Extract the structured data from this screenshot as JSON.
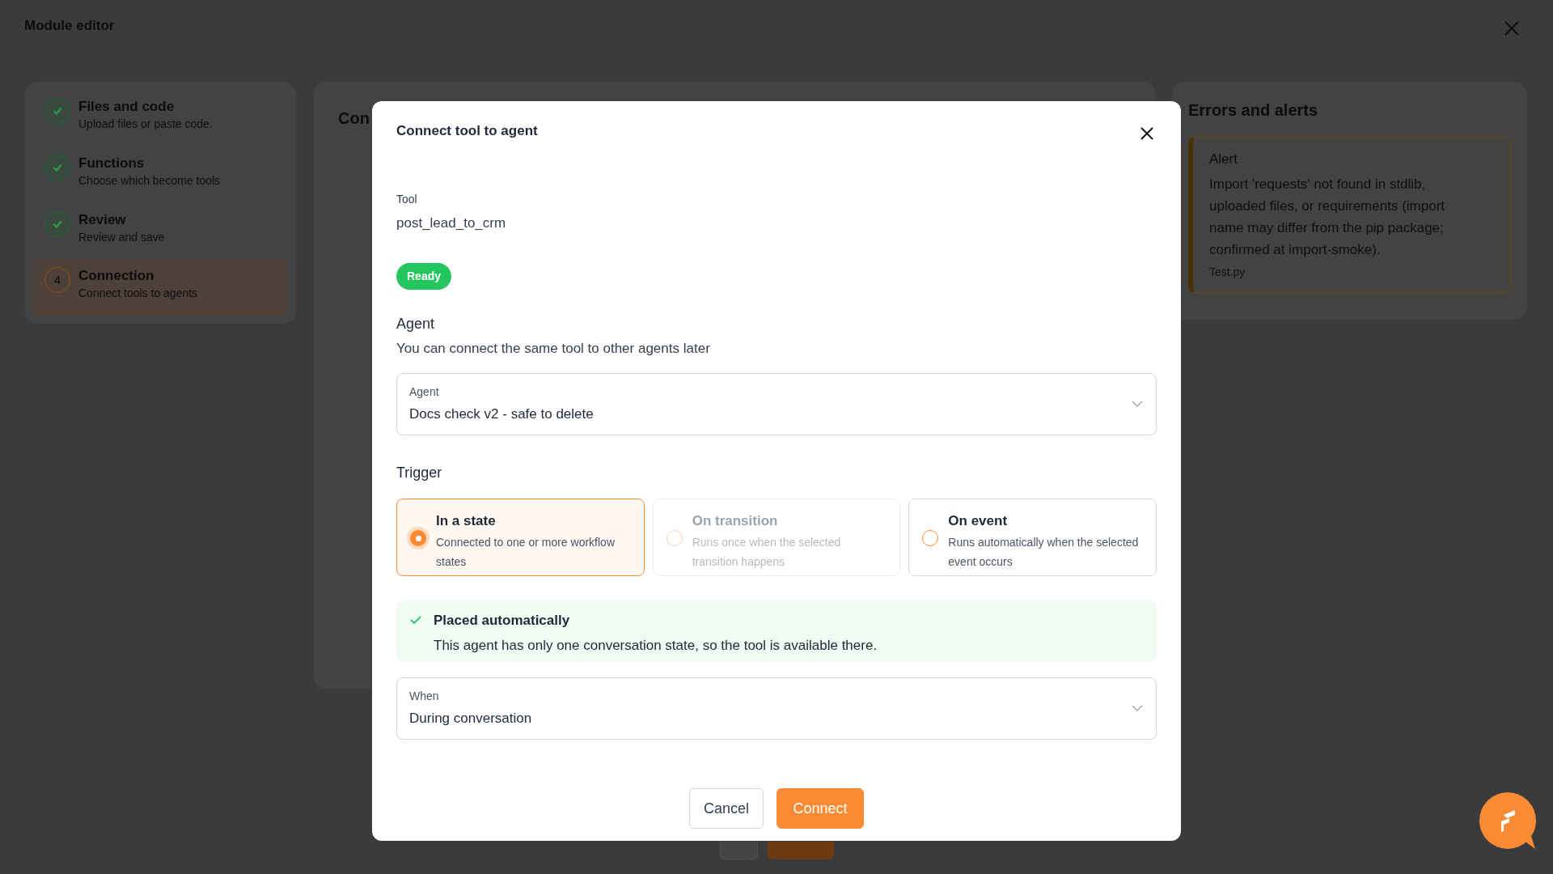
{
  "page": {
    "title": "Module editor"
  },
  "steps": [
    {
      "title": "Files and code",
      "subtitle": "Upload files or paste code.",
      "completed": true,
      "selected": false
    },
    {
      "title": "Functions",
      "subtitle": "Choose which become tools",
      "completed": true,
      "selected": false
    },
    {
      "title": "Review",
      "subtitle": "Review and save",
      "completed": true,
      "selected": false
    },
    {
      "title": "Connection",
      "subtitle": "Connect tools to agents",
      "completed": false,
      "selected": true,
      "number": "4"
    }
  ],
  "main_panel": {
    "title": "Con"
  },
  "errors_panel": {
    "title": "Errors and alerts",
    "alerts": [
      {
        "title": "Alert",
        "message": "Import 'requests' not found in stdlib, uploaded files, or requirements (import name may differ from the pip package; confirmed at import-smoke).",
        "file": "Test.py"
      }
    ]
  },
  "dialog": {
    "title": "Connect tool to agent",
    "tool": {
      "label": "Tool",
      "value": "post_lead_to_crm"
    },
    "status_badge": "Ready",
    "agent_section": {
      "heading": "Agent",
      "description": "You can connect the same tool to other agents later"
    },
    "agent_select": {
      "label": "Agent",
      "value": "Docs check v2 - safe to delete"
    },
    "trigger_heading": "Trigger",
    "triggers": [
      {
        "title": "In a state",
        "description": "Connected to one or more workflow states",
        "selected": true,
        "disabled": false
      },
      {
        "title": "On transition",
        "description": "Runs once when the selected transition happens",
        "selected": false,
        "disabled": true
      },
      {
        "title": "On event",
        "description": "Runs automatically when the selected event occurs",
        "selected": false,
        "disabled": false
      }
    ],
    "notice": {
      "title": "Placed automatically",
      "message": "This agent has only one conversation state, so the tool is available there."
    },
    "when_select": {
      "label": "When",
      "value": "During conversation"
    },
    "buttons": [
      {
        "label": "Cancel",
        "kind": "secondary"
      },
      {
        "label": "Connect",
        "kind": "primary"
      }
    ]
  }
}
